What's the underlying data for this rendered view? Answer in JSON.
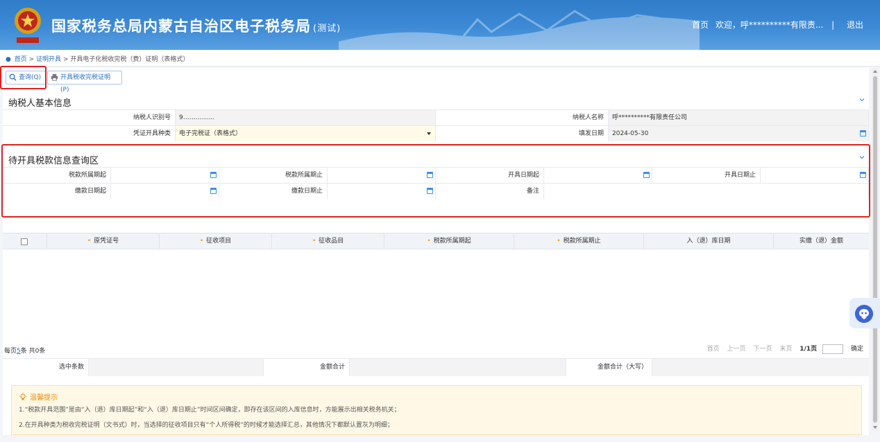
{
  "header": {
    "title": "国家税务总局内蒙古自治区电子税务局",
    "test_tag": "(测试)",
    "nav_home": "首页",
    "nav_welcome": "欢迎，呼**********有限责...",
    "nav_sep": "|",
    "nav_logout": "退出"
  },
  "breadcrumb": {
    "home": "首页",
    "sep1": ">",
    "level2": "证明开具",
    "sep2": ">",
    "current": "开具电子化税收完税（费）证明（表格式）"
  },
  "toolbar": {
    "query_label": "查询(Q)",
    "print_label": "开具税收完税证明(P)"
  },
  "taxpayer": {
    "section_title": "纳税人基本信息",
    "id_label": "纳税人识别号",
    "id_value": "9……………",
    "name_label": "纳税人名称",
    "name_value": "呼**********有限责任公司",
    "type_label": "凭证开具种类",
    "type_value": "电子完税证（表格式）",
    "date_label": "填发日期",
    "date_value": "2024-05-30"
  },
  "query": {
    "section_title": "待开具税款信息查询区",
    "period_start": "税款所属期起",
    "period_end": "税款所属期止",
    "issue_start": "开具日期起",
    "issue_end": "开具日期止",
    "pay_start": "缴款日期起",
    "pay_end": "缴款日期止",
    "remark": "备注"
  },
  "grid": {
    "columns": [
      "原凭证号",
      "征收项目",
      "征收品目",
      "税款所属期起",
      "税款所属期止",
      "入（退）库日期",
      "实缴（退）金额"
    ]
  },
  "pager": {
    "per_page_prefix": "每页",
    "per_page_value": "5",
    "per_page_suffix": "条 共0条",
    "first": "首页",
    "prev": "上一页",
    "next": "下一页",
    "last": "末页",
    "page_info": "1/1页",
    "confirm": "确定"
  },
  "summary": {
    "selected_label": "选中条数",
    "amount_label": "金额合计",
    "amount_upper_label": "金额合计（大写）"
  },
  "tips": {
    "title": "温馨提示",
    "line1": "1.“税款开具范围”是由“入（退）库日期起”和“入（退）库日期止”时间区间确定，即存在该区间的入库信息时，方能展示出相关税务机关；",
    "line2": "2.在开具种类为税收完税证明（文书式）时，当选择的征收项目只有“个人所得税”的时候才能选择汇总，其他情况下都默认置灰为明细；"
  },
  "colors": {
    "header_blue": "#2f7cc8",
    "link_blue": "#2b6fc2",
    "highlight_red": "#e02020",
    "tip_orange": "#f08a00"
  }
}
